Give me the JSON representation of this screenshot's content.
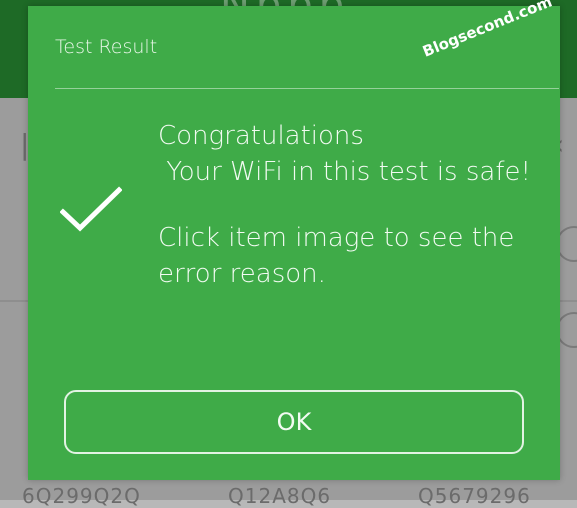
{
  "dialog": {
    "title": "Test Result",
    "watermark": "Blogsecond.com",
    "message_line1": "Congratulations",
    "message_line2": " Your WiFi in this test is safe!",
    "message_line3": "Click item image to see the",
    "message_line4": "error reason.",
    "ok_label": "OK",
    "status_icon": "check-icon"
  },
  "background": {
    "header_title": "Nbbb",
    "item_labels": [
      "6Q299Q2Q",
      "Q12A8Q6",
      "Q5679296"
    ]
  },
  "colors": {
    "dialog_bg": "#3fab48",
    "header_bg": "#1e6a26",
    "text": "#f2fbf2"
  }
}
